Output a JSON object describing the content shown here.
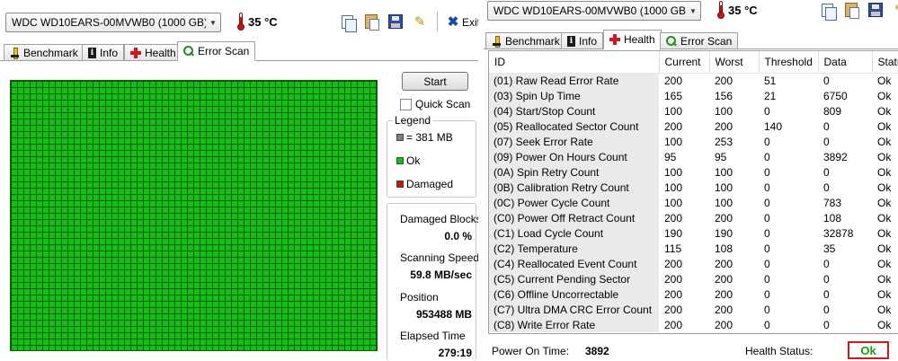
{
  "left_window": {
    "drive": "WDC WD10EARS-00MVWB0 (1000 GB)",
    "temperature": "35 °C",
    "exit_label": "Exit",
    "tabs": [
      {
        "label": "Benchmark",
        "icon": "benchmark-icon"
      },
      {
        "label": "Info",
        "icon": "info-icon"
      },
      {
        "label": "Health",
        "icon": "health-icon"
      },
      {
        "label": "Error Scan",
        "icon": "error-scan-icon",
        "active": true
      }
    ],
    "start_button": "Start",
    "quick_scan_label": "Quick Scan",
    "legend": {
      "title": "Legend",
      "block": "= 381 MB",
      "ok": "Ok",
      "damaged": "Damaged",
      "colors": {
        "block": "#808080",
        "ok": "#10c010",
        "damaged": "#c81414"
      }
    },
    "stats": {
      "damaged_blocks_label": "Damaged Blocks",
      "damaged_blocks_value": "0.0 %",
      "scanning_speed_label": "Scanning Speed",
      "scanning_speed_value": "59.8 MB/sec",
      "position_label": "Position",
      "position_value": "953488 MB",
      "elapsed_time_label": "Elapsed Time",
      "elapsed_time_value": "279:19"
    }
  },
  "right_window": {
    "drive": "WDC WD10EARS-00MVWB0 (1000 GB)",
    "temperature": "35 °C",
    "tabs": [
      {
        "label": "Benchmark",
        "icon": "benchmark-icon"
      },
      {
        "label": "Info",
        "icon": "info-icon"
      },
      {
        "label": "Health",
        "icon": "health-icon",
        "active": true
      },
      {
        "label": "Error Scan",
        "icon": "error-scan-icon"
      }
    ],
    "columns": [
      "ID",
      "Current",
      "Worst",
      "Threshold",
      "Data",
      "Status"
    ],
    "rows": [
      [
        "(01) Raw Read Error Rate",
        "200",
        "200",
        "51",
        "0",
        "Ok"
      ],
      [
        "(03) Spin Up Time",
        "165",
        "156",
        "21",
        "6750",
        "Ok"
      ],
      [
        "(04) Start/Stop Count",
        "100",
        "100",
        "0",
        "809",
        "Ok"
      ],
      [
        "(05) Reallocated Sector Count",
        "200",
        "200",
        "140",
        "0",
        "Ok"
      ],
      [
        "(07) Seek Error Rate",
        "100",
        "253",
        "0",
        "0",
        "Ok"
      ],
      [
        "(09) Power On Hours Count",
        "95",
        "95",
        "0",
        "3892",
        "Ok"
      ],
      [
        "(0A) Spin Retry Count",
        "100",
        "100",
        "0",
        "0",
        "Ok"
      ],
      [
        "(0B) Calibration Retry Count",
        "100",
        "100",
        "0",
        "0",
        "Ok"
      ],
      [
        "(0C) Power Cycle Count",
        "100",
        "100",
        "0",
        "783",
        "Ok"
      ],
      [
        "(C0) Power Off Retract Count",
        "200",
        "200",
        "0",
        "108",
        "Ok"
      ],
      [
        "(C1) Load Cycle Count",
        "190",
        "190",
        "0",
        "32878",
        "Ok"
      ],
      [
        "(C2) Temperature",
        "115",
        "108",
        "0",
        "35",
        "Ok"
      ],
      [
        "(C4) Reallocated Event Count",
        "200",
        "200",
        "0",
        "0",
        "Ok"
      ],
      [
        "(C5) Current Pending Sector",
        "200",
        "200",
        "0",
        "0",
        "Ok"
      ],
      [
        "(C6) Offline Uncorrectable",
        "200",
        "200",
        "0",
        "0",
        "Ok"
      ],
      [
        "(C7) Ultra DMA CRC Error Count",
        "200",
        "200",
        "0",
        "0",
        "Ok"
      ],
      [
        "(C8) Write Error Rate",
        "200",
        "200",
        "0",
        "0",
        "Ok"
      ]
    ],
    "power_on_time_label": "Power On Time:",
    "power_on_time_value": "3892",
    "health_status_label": "Health Status:",
    "health_status_value": "Ok"
  }
}
